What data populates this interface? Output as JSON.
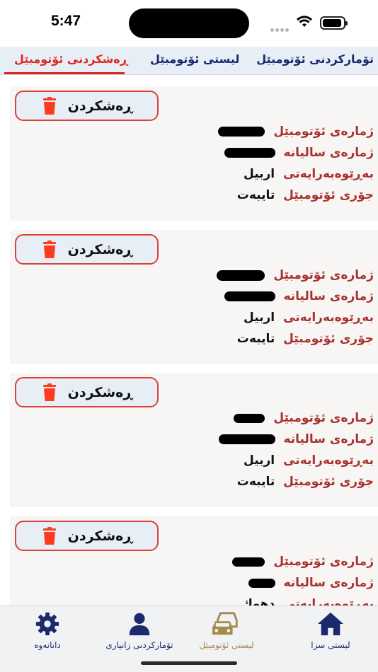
{
  "status": {
    "time": "5:47"
  },
  "top_tabs": {
    "register_car": "تۆمارکردنی ئۆتومبێل",
    "car_list": "لیستی ئۆتومبێل",
    "delete_car": "ڕەشکردنی ئۆتومبێل"
  },
  "labels": {
    "delete_button": "ڕەشکردن",
    "car_number": "ژمارەی ئۆتومبێل",
    "annual_number": "ژمارەی سالیانە",
    "directorate": "بەڕێوەبەرایەتی",
    "car_type": "جۆری ئۆتومبێل"
  },
  "cars": [
    {
      "directorate": "اربیل",
      "type": "تایبەت"
    },
    {
      "directorate": "اربیل",
      "type": "تایبەت"
    },
    {
      "directorate": "اربیل",
      "type": "تایبەت"
    },
    {
      "directorate": "دهوك",
      "type": ""
    }
  ],
  "bottom_nav": {
    "settings": "دانانەوە",
    "register_info": "تۆمارکردنی زانیاری",
    "car_list": "لیستی ئۆتومبێل",
    "fines_list": "لیستی سزا"
  },
  "colors": {
    "accent_red": "#e0261f",
    "label_red": "#a8322d",
    "navy": "#1a2a6c",
    "active_gold": "#a58a4b"
  }
}
